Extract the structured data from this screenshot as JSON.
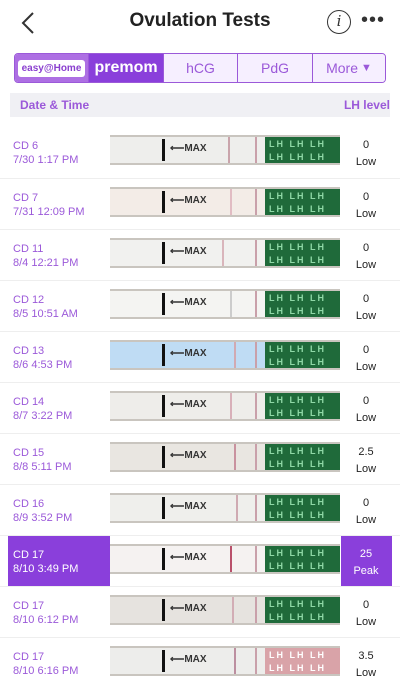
{
  "header": {
    "title": "Ovulation Tests",
    "info_icon": "info-icon",
    "more_icon": "more-options-icon"
  },
  "tabs": {
    "easy_at_home": "easy@Home",
    "premom": "premom",
    "hcg": "hCG",
    "pdg": "PdG",
    "more": "More"
  },
  "subheader": {
    "left": "Date & Time",
    "right": "LH level"
  },
  "colors": {
    "accent": "#9b59d9",
    "selected": "#8a3fdb",
    "grip_green": "#1f6a3a"
  },
  "tests": [
    {
      "cd": "CD 6",
      "datetime": "7/30 1:17 PM",
      "lh_value": "0",
      "lh_label": "Low",
      "selected": false
    },
    {
      "cd": "CD 7",
      "datetime": "7/31 12:09 PM",
      "lh_value": "0",
      "lh_label": "Low",
      "selected": false
    },
    {
      "cd": "CD 11",
      "datetime": "8/4 12:21 PM",
      "lh_value": "0",
      "lh_label": "Low",
      "selected": false
    },
    {
      "cd": "CD 12",
      "datetime": "8/5 10:51 AM",
      "lh_value": "0",
      "lh_label": "Low",
      "selected": false
    },
    {
      "cd": "CD 13",
      "datetime": "8/6 4:53 PM",
      "lh_value": "0",
      "lh_label": "Low",
      "selected": false
    },
    {
      "cd": "CD 14",
      "datetime": "8/7 3:22 PM",
      "lh_value": "0",
      "lh_label": "Low",
      "selected": false
    },
    {
      "cd": "CD 15",
      "datetime": "8/8 5:11 PM",
      "lh_value": "2.5",
      "lh_label": "Low",
      "selected": false
    },
    {
      "cd": "CD 16",
      "datetime": "8/9 3:52 PM",
      "lh_value": "0",
      "lh_label": "Low",
      "selected": false
    },
    {
      "cd": "CD 17",
      "datetime": "8/10 3:49 PM",
      "lh_value": "25",
      "lh_label": "Peak",
      "selected": true
    },
    {
      "cd": "CD 17",
      "datetime": "8/10 6:12 PM",
      "lh_value": "0",
      "lh_label": "Low",
      "selected": false
    },
    {
      "cd": "CD 17",
      "datetime": "8/10 6:16 PM",
      "lh_value": "3.5",
      "lh_label": "Low",
      "selected": false
    }
  ],
  "strip": {
    "max_text": "⟵MAX",
    "grip_text": "LH LH LH LH LH LH LH LH LH LH LH LH"
  }
}
